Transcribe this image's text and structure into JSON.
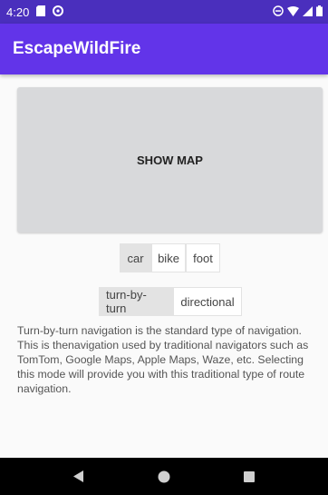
{
  "status_bar": {
    "time": "4:20",
    "icons_left": [
      "sd-card-icon",
      "target-icon"
    ],
    "icons_right": [
      "do-not-disturb-icon",
      "wifi-icon",
      "cell-signal-icon",
      "battery-icon"
    ]
  },
  "app_bar": {
    "title": "EscapeWildFire"
  },
  "map_button": {
    "label": "SHOW MAP"
  },
  "transport_modes": [
    {
      "label": "car",
      "selected": true
    },
    {
      "label": "bike",
      "selected": false
    },
    {
      "label": "foot",
      "selected": false
    }
  ],
  "navigation_types": [
    {
      "label": "turn-by-turn",
      "selected": true
    },
    {
      "label": "directional",
      "selected": false
    }
  ],
  "description": "Turn-by-turn navigation is the standard type of navigation. This is thenavigation used by traditional navigators such as TomTom, Google Maps, Apple Maps, Waze, etc. Selecting this mode will provide you with this traditional type of route navigation.",
  "system_nav": [
    "back-icon",
    "home-icon",
    "recents-icon"
  ],
  "colors": {
    "status_bar": "#4a2fbd",
    "app_bar": "#6234e9",
    "map_button": "#d8d9db",
    "selected_segment": "#e3e3e3"
  }
}
